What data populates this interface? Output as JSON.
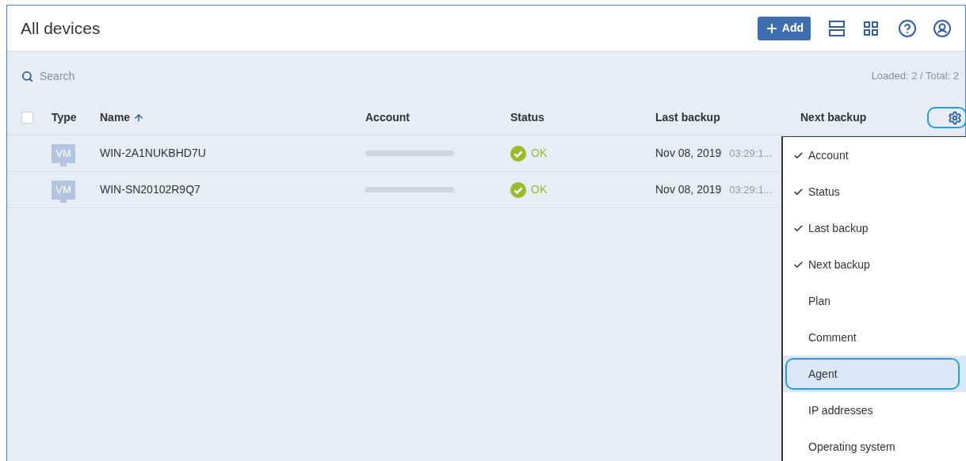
{
  "header": {
    "title": "All devices",
    "add_button": "Add"
  },
  "search": {
    "placeholder": "Search"
  },
  "counter": "Loaded: 2 / Total: 2",
  "table": {
    "select_all": {
      "checked": false
    },
    "columns": [
      {
        "label": "Type"
      },
      {
        "label": "Name",
        "sorted_ascending": true
      },
      {
        "label": "Account"
      },
      {
        "label": "Status"
      },
      {
        "label": "Last backup"
      },
      {
        "label": "Next backup"
      }
    ],
    "rows": [
      {
        "type": "VM",
        "name": "WIN-2A1NUKBHD7U",
        "status": "OK",
        "date": "Nov 08, 2019",
        "time": "03:29:1..."
      },
      {
        "type": "VM",
        "name": "WIN-SN20102R9Q7",
        "status": "OK",
        "date": "Nov 08, 2019",
        "time": "03:29:1..."
      }
    ]
  },
  "column_menu": {
    "items": [
      {
        "label": "Account",
        "checked": true,
        "selected": false
      },
      {
        "label": "Status",
        "checked": true,
        "selected": false
      },
      {
        "label": "Last backup",
        "checked": true,
        "selected": false
      },
      {
        "label": "Next backup",
        "checked": true,
        "selected": false
      },
      {
        "label": "Plan",
        "checked": false,
        "selected": false
      },
      {
        "label": "Comment",
        "checked": false,
        "selected": false
      },
      {
        "label": "Agent",
        "checked": false,
        "selected": true
      },
      {
        "label": "IP addresses",
        "checked": false,
        "selected": false
      },
      {
        "label": "Operating system",
        "checked": false,
        "selected": false
      }
    ]
  }
}
